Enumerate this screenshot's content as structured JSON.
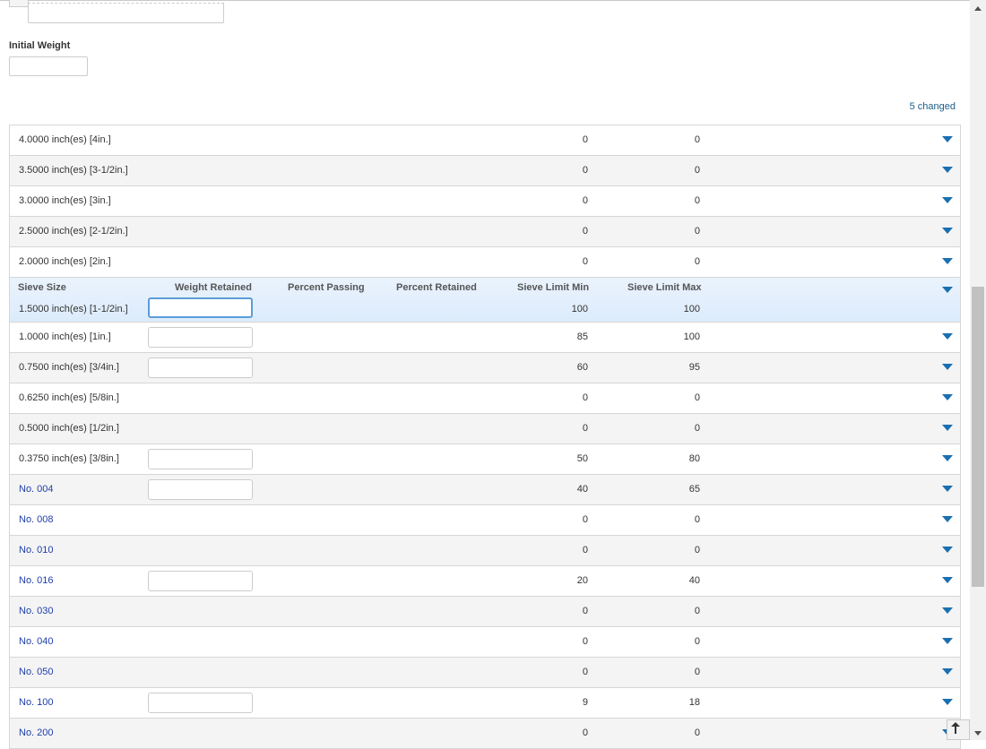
{
  "form": {
    "initial_weight_label": "Initial Weight",
    "initial_weight_value": "",
    "changed_link": "5 changed"
  },
  "grid": {
    "headers": {
      "sieve_size": "Sieve Size",
      "weight_retained": "Weight Retained",
      "percent_passing": "Percent Passing",
      "percent_retained": "Percent Retained",
      "sieve_limit_min": "Sieve Limit Min",
      "sieve_limit_max": "Sieve Limit Max"
    },
    "rows": [
      {
        "size": "4.0000 inch(es) [4in.]",
        "min": "0",
        "max": "0",
        "input": false,
        "link": false
      },
      {
        "size": "3.5000 inch(es) [3-1/2in.]",
        "min": "0",
        "max": "0",
        "input": false,
        "link": false
      },
      {
        "size": "3.0000 inch(es) [3in.]",
        "min": "0",
        "max": "0",
        "input": false,
        "link": false
      },
      {
        "size": "2.5000 inch(es) [2-1/2in.]",
        "min": "0",
        "max": "0",
        "input": false,
        "link": false
      },
      {
        "size": "2.0000 inch(es) [2in.]",
        "min": "0",
        "max": "0",
        "input": false,
        "link": false
      },
      {
        "size": "1.5000 inch(es) [1-1/2in.]",
        "min": "100",
        "max": "100",
        "input": true,
        "link": false,
        "expanded": true
      },
      {
        "size": "1.0000 inch(es) [1in.]",
        "min": "85",
        "max": "100",
        "input": true,
        "link": false
      },
      {
        "size": "0.7500 inch(es) [3/4in.]",
        "min": "60",
        "max": "95",
        "input": true,
        "link": false
      },
      {
        "size": "0.6250 inch(es) [5/8in.]",
        "min": "0",
        "max": "0",
        "input": false,
        "link": false
      },
      {
        "size": "0.5000 inch(es) [1/2in.]",
        "min": "0",
        "max": "0",
        "input": false,
        "link": false
      },
      {
        "size": "0.3750 inch(es) [3/8in.]",
        "min": "50",
        "max": "80",
        "input": true,
        "link": false
      },
      {
        "size": "No. 004",
        "min": "40",
        "max": "65",
        "input": true,
        "link": true
      },
      {
        "size": "No. 008",
        "min": "0",
        "max": "0",
        "input": false,
        "link": true
      },
      {
        "size": "No. 010",
        "min": "0",
        "max": "0",
        "input": false,
        "link": true
      },
      {
        "size": "No. 016",
        "min": "20",
        "max": "40",
        "input": true,
        "link": true
      },
      {
        "size": "No. 030",
        "min": "0",
        "max": "0",
        "input": false,
        "link": true
      },
      {
        "size": "No. 040",
        "min": "0",
        "max": "0",
        "input": false,
        "link": true
      },
      {
        "size": "No. 050",
        "min": "0",
        "max": "0",
        "input": false,
        "link": true
      },
      {
        "size": "No. 100",
        "min": "9",
        "max": "18",
        "input": true,
        "link": true
      },
      {
        "size": "No. 200",
        "min": "0",
        "max": "0",
        "input": false,
        "link": true
      }
    ]
  },
  "icons": {
    "row_toggle": "chevron-down-icon",
    "back_to_top": "arrow-up-icon"
  },
  "colors": {
    "accent": "#1a6fb0",
    "link": "#1f3fa8",
    "changed_link": "#1a5e8c",
    "selected_row": "#e3effc"
  }
}
